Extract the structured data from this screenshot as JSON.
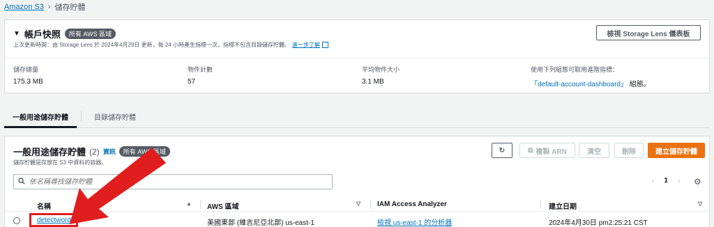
{
  "breadcrumb": {
    "root": "Amazon S3",
    "separator": "›",
    "current": "儲存貯體"
  },
  "snapshot": {
    "title": "帳戶快照",
    "badge": "所有 AWS 區域",
    "subtitle": "上次更新時間：由 Storage Lens 於 2024年4月29日 更新，每 24 小時產生指標一次，指標不包含目錄儲存貯體。",
    "learn_more": "進一步了解",
    "lens_button": "檢視 Storage Lens 儀表板",
    "metrics": [
      {
        "label": "儲存總量",
        "value": "175.3 MB"
      },
      {
        "label": "物件計數",
        "value": "57"
      },
      {
        "label": "平均物件大小",
        "value": "3.1 MB"
      }
    ],
    "dashboard_label": "使用下列組態可取用進階指標：",
    "dashboard_link": "「default-account-dashboard」",
    "dashboard_suffix": "組態。"
  },
  "tabs": [
    {
      "label": "一般用途儲存貯體"
    },
    {
      "label": "目錄儲存貯體"
    }
  ],
  "buckets": {
    "title": "一般用途儲存貯體",
    "count": "(2)",
    "info": "資訊",
    "badge": "所有 AWS 區域",
    "subtitle": "儲存貯體是存放在 S3 中資料的容器。",
    "actions": {
      "refresh": "↻",
      "copy_arn": "複製 ARN",
      "empty": "清空",
      "delete": "刪除",
      "create": "建立儲存貯體"
    },
    "search_placeholder": "依名稱尋找儲存貯體",
    "page": "1",
    "columns": [
      "名稱",
      "AWS 區域",
      "IAM Access Analyzer",
      "建立日期"
    ],
    "rows": [
      {
        "name": "detectword",
        "region": "美國東部 (維吉尼亞北部) us-east-1",
        "analyzer": "檢視 us-east-1 的分析器",
        "created": "2024年4月30日 pm2:25:21 CST"
      }
    ]
  },
  "colors": {
    "accent": "#0073bb",
    "primary_button": "#ec7211",
    "annotation": "#e01e1e"
  }
}
